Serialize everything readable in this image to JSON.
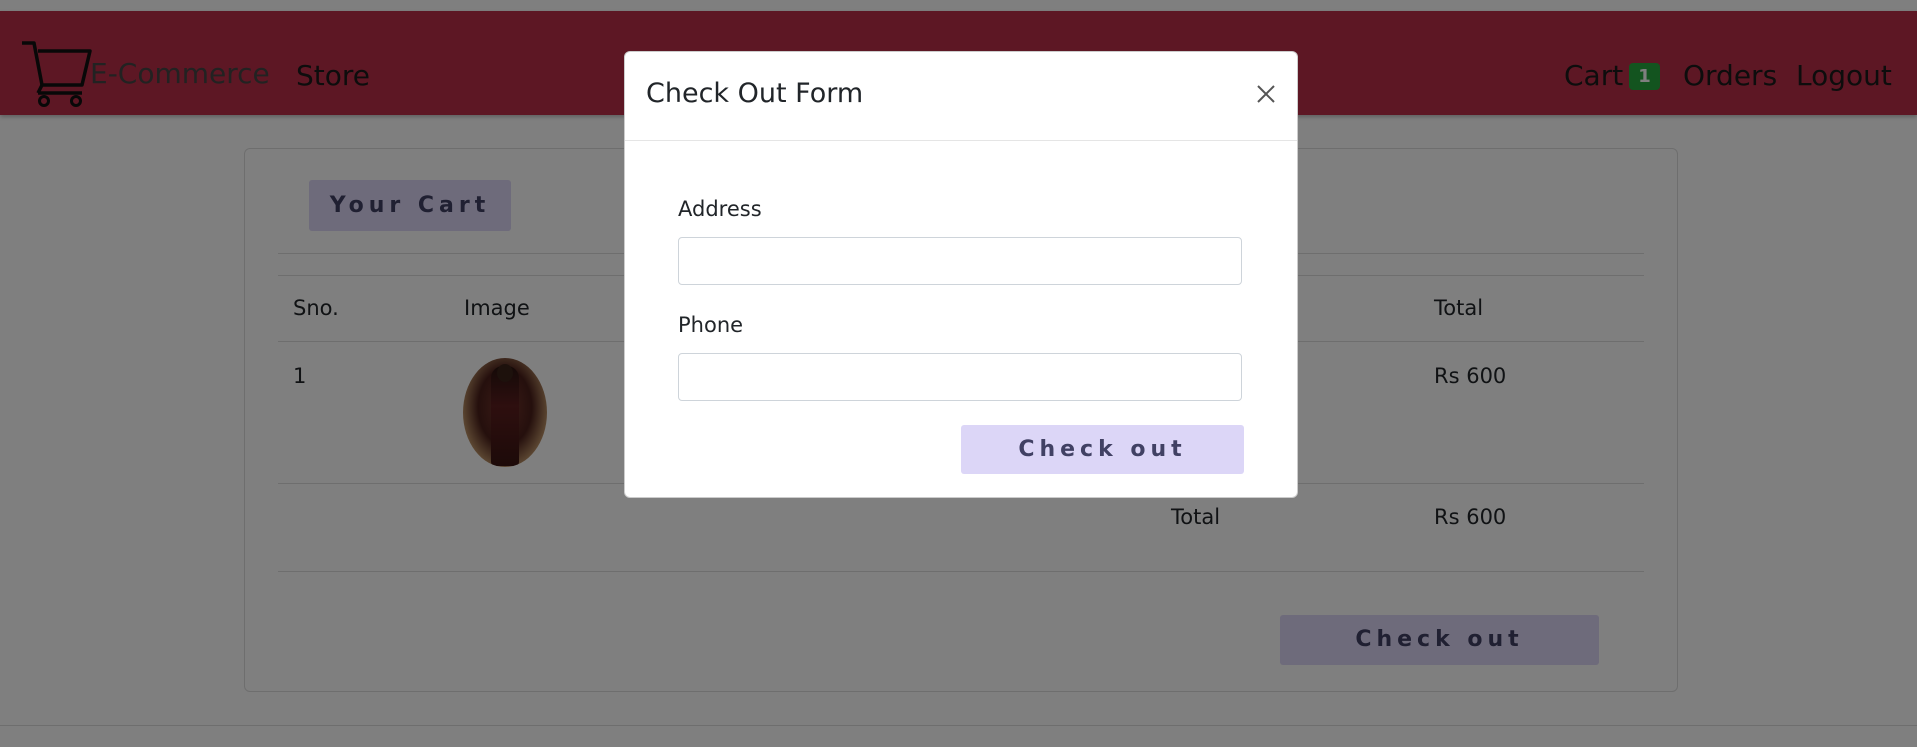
{
  "navbar": {
    "brand": "E-Commerce",
    "store_link": "Store",
    "cart_link": "Cart",
    "cart_count": "1",
    "orders_link": "Orders",
    "logout_link": "Logout",
    "brand_color": "#bb2f48",
    "badge_color": "#26a83e"
  },
  "cart": {
    "title_button": "Your Cart",
    "columns": [
      "Sno.",
      "Image",
      "Total"
    ],
    "rows": [
      {
        "sno": "1",
        "image": "product-photo",
        "total": "Rs 600"
      }
    ],
    "grand_total_label": "Total",
    "grand_total_value": "Rs 600",
    "checkout_button": "Check out"
  },
  "modal": {
    "title": "Check Out Form",
    "address_label": "Address",
    "address_value": "",
    "phone_label": "Phone",
    "phone_value": "",
    "submit_button": "Check out",
    "close_icon": "close-icon"
  },
  "colors": {
    "accent_button": "#dcd6f7",
    "accent_button_text": "#414164"
  }
}
